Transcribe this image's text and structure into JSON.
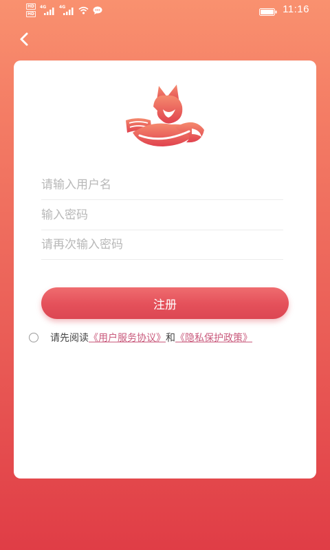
{
  "status_bar": {
    "hd_label": "HD",
    "network_label": "4G",
    "time": "11:16",
    "icons": [
      "hd-icon",
      "signal-icon",
      "wifi-icon",
      "message-icon",
      "battery-icon"
    ]
  },
  "header": {
    "back_icon": "chevron-left-icon"
  },
  "logo": {
    "icon": "fox-logo-icon"
  },
  "form": {
    "username": {
      "placeholder": "请输入用户名",
      "value": ""
    },
    "password": {
      "placeholder": "输入密码",
      "value": ""
    },
    "confirm_password": {
      "placeholder": "请再次输入密码",
      "value": ""
    },
    "register_label": "注册"
  },
  "agreement": {
    "prefix": "请先阅读",
    "user_agreement": "《用户服务协议》",
    "conjunction": "和",
    "privacy_policy": "《隐私保护政策》"
  },
  "colors": {
    "accent": "#e4505a",
    "link": "#c95a7c",
    "background_top": "#f9916f",
    "background_bottom": "#e03d46"
  }
}
